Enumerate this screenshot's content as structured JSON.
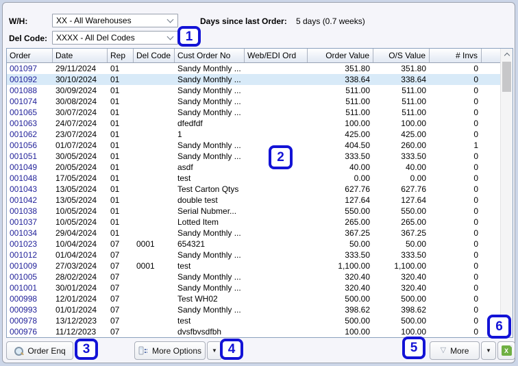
{
  "filters": {
    "wh_label": "W/H:",
    "wh_value": "XX - All Warehouses",
    "del_code_label": "Del Code:",
    "del_code_value": "XXXX - All Del Codes",
    "days_label": "Days since last Order:",
    "days_value": "5 days (0.7 weeks)"
  },
  "table": {
    "columns": [
      "Order",
      "Date",
      "Rep",
      "Del Code",
      "Cust Order No",
      "Web/EDI Ord",
      "Order Value",
      "O/S Value",
      "# Invs"
    ],
    "selected_index": 1,
    "rows": [
      [
        "001097",
        "29/11/2024",
        "01",
        "",
        "Sandy Monthly ...",
        "",
        "351.80",
        "351.80",
        "0"
      ],
      [
        "001092",
        "30/10/2024",
        "01",
        "",
        "Sandy Monthly ...",
        "",
        "338.64",
        "338.64",
        "0"
      ],
      [
        "001088",
        "30/09/2024",
        "01",
        "",
        "Sandy Monthly ...",
        "",
        "511.00",
        "511.00",
        "0"
      ],
      [
        "001074",
        "30/08/2024",
        "01",
        "",
        "Sandy Monthly ...",
        "",
        "511.00",
        "511.00",
        "0"
      ],
      [
        "001065",
        "30/07/2024",
        "01",
        "",
        "Sandy Monthly ...",
        "",
        "511.00",
        "511.00",
        "0"
      ],
      [
        "001063",
        "24/07/2024",
        "01",
        "",
        "dfedfdf",
        "",
        "100.00",
        "100.00",
        "0"
      ],
      [
        "001062",
        "23/07/2024",
        "01",
        "",
        "1",
        "",
        "425.00",
        "425.00",
        "0"
      ],
      [
        "001056",
        "01/07/2024",
        "01",
        "",
        "Sandy Monthly ...",
        "",
        "404.50",
        "260.00",
        "1"
      ],
      [
        "001051",
        "30/05/2024",
        "01",
        "",
        "Sandy Monthly ...",
        "",
        "333.50",
        "333.50",
        "0"
      ],
      [
        "001049",
        "20/05/2024",
        "01",
        "",
        "asdf",
        "",
        "40.00",
        "40.00",
        "0"
      ],
      [
        "001048",
        "17/05/2024",
        "01",
        "",
        "test",
        "",
        "0.00",
        "0.00",
        "0"
      ],
      [
        "001043",
        "13/05/2024",
        "01",
        "",
        "Test Carton Qtys",
        "",
        "627.76",
        "627.76",
        "0"
      ],
      [
        "001042",
        "13/05/2024",
        "01",
        "",
        "double test",
        "",
        "127.64",
        "127.64",
        "0"
      ],
      [
        "001038",
        "10/05/2024",
        "01",
        "",
        "Serial Nubmer...",
        "",
        "550.00",
        "550.00",
        "0"
      ],
      [
        "001037",
        "10/05/2024",
        "01",
        "",
        "Lotted Item",
        "",
        "265.00",
        "265.00",
        "0"
      ],
      [
        "001034",
        "29/04/2024",
        "01",
        "",
        "Sandy Monthly ...",
        "",
        "367.25",
        "367.25",
        "0"
      ],
      [
        "001023",
        "10/04/2024",
        "07",
        "0001",
        "654321",
        "",
        "50.00",
        "50.00",
        "0"
      ],
      [
        "001012",
        "01/04/2024",
        "07",
        "",
        "Sandy Monthly ...",
        "",
        "333.50",
        "333.50",
        "0"
      ],
      [
        "001009",
        "27/03/2024",
        "07",
        "0001",
        "test",
        "",
        "1,100.00",
        "1,100.00",
        "0"
      ],
      [
        "001005",
        "28/02/2024",
        "07",
        "",
        "Sandy Monthly ...",
        "",
        "320.40",
        "320.40",
        "0"
      ],
      [
        "001001",
        "30/01/2024",
        "07",
        "",
        "Sandy Monthly ...",
        "",
        "320.40",
        "320.40",
        "0"
      ],
      [
        "000998",
        "12/01/2024",
        "07",
        "",
        "Test WH02",
        "",
        "500.00",
        "500.00",
        "0"
      ],
      [
        "000993",
        "01/01/2024",
        "07",
        "",
        "Sandy Monthly ...",
        "",
        "398.62",
        "398.62",
        "0"
      ],
      [
        "000978",
        "13/12/2023",
        "07",
        "",
        "test",
        "",
        "500.00",
        "500.00",
        "0"
      ],
      [
        "000976",
        "11/12/2023",
        "07",
        "",
        "dvsfbvsdfbh",
        "",
        "100.00",
        "100.00",
        "0"
      ]
    ]
  },
  "toolbar": {
    "order_enq_label": "Order Enq",
    "more_options_label": "More Options",
    "more_label": "More",
    "more_glyph": "▽",
    "split_arrow_glyph": "▼"
  },
  "callouts": [
    "1",
    "2",
    "3",
    "4",
    "5",
    "6"
  ],
  "colors": {
    "callout_blue": "#1313d6",
    "selected_row": "#d8eaf8",
    "order_link_navy": "#22229a",
    "excel_green": "#6fb043"
  }
}
